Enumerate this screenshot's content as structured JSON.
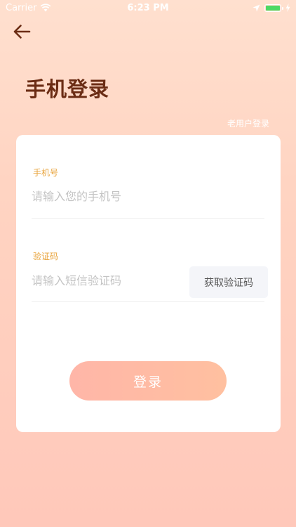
{
  "status_bar": {
    "carrier": "Carrier",
    "time": "6:23 PM",
    "battery_level": 1.0
  },
  "page": {
    "title": "手机登录",
    "old_user_login": "老用户登录"
  },
  "phone_field": {
    "label": "手机号",
    "placeholder": "请输入您的手机号",
    "value": ""
  },
  "code_field": {
    "label": "验证码",
    "placeholder": "请输入短信验证码",
    "value": "",
    "get_code_label": "获取验证码"
  },
  "login_button": {
    "label": "登录"
  },
  "colors": {
    "title": "#6b2c14",
    "label": "#e8a33a",
    "battery": "#4cd964"
  },
  "icons": {
    "back": "arrow-left-icon",
    "wifi": "wifi-icon",
    "location": "location-arrow-icon",
    "charging": "charging-bolt-icon"
  }
}
